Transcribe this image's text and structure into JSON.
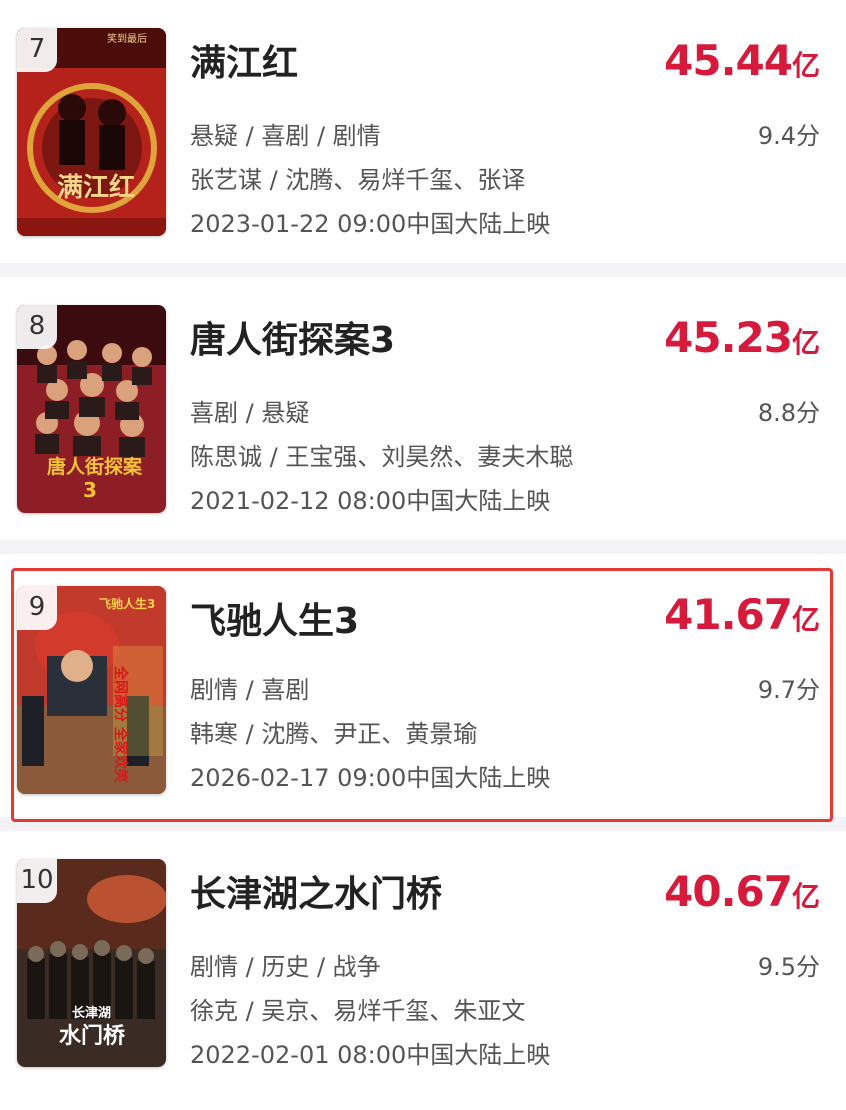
{
  "movies": [
    {
      "rank": "7",
      "title": "满江红",
      "box_num": "45.44",
      "box_unit": "亿",
      "genres": "悬疑 / 喜剧 / 剧情",
      "score": "9.4分",
      "people": "张艺谋 / 沈腾、易烊千玺、张译",
      "release": "2023-01-22 09:00中国大陆上映",
      "poster_text": "满江红",
      "poster_top_text": "笑到最后",
      "colors": {
        "bg": "#b5211b",
        "accent": "#e0a53a",
        "dark": "#4a0d0a"
      }
    },
    {
      "rank": "8",
      "title": "唐人街探案3",
      "box_num": "45.23",
      "box_unit": "亿",
      "genres": "喜剧 / 悬疑",
      "score": "8.8分",
      "people": "陈思诚 / 王宝强、刘昊然、妻夫木聪",
      "release": "2021-02-12 08:00中国大陆上映",
      "poster_text": "唐人街探案",
      "poster_num": "3",
      "colors": {
        "bg": "#8e1e25",
        "accent": "#f2c23a",
        "dark": "#3c0b10"
      }
    },
    {
      "rank": "9",
      "title": "飞驰人生3",
      "box_num": "41.67",
      "box_unit": "亿",
      "genres": "剧情 / 喜剧",
      "score": "9.7分",
      "people": "韩寒 / 沈腾、尹正、黄景瑜",
      "release": "2026-02-17 09:00中国大陆上映",
      "poster_text": "全网高分 全家欢笑",
      "poster_top_text": "飞驰人生3",
      "colors": {
        "bg": "#c23a2c",
        "accent": "#f5d24b",
        "dark": "#6b2a1c"
      }
    },
    {
      "rank": "10",
      "title": "长津湖之水门桥",
      "box_num": "40.67",
      "box_unit": "亿",
      "genres": "剧情 / 历史 / 战争",
      "score": "9.5分",
      "people": "徐克 / 吴京、易烊千玺、朱亚文",
      "release": "2022-02-01 08:00中国大陆上映",
      "poster_text": "水门桥",
      "poster_top_text": "长津湖",
      "colors": {
        "bg": "#3a2c25",
        "accent": "#e2643a",
        "dark": "#1b1512"
      }
    }
  ]
}
